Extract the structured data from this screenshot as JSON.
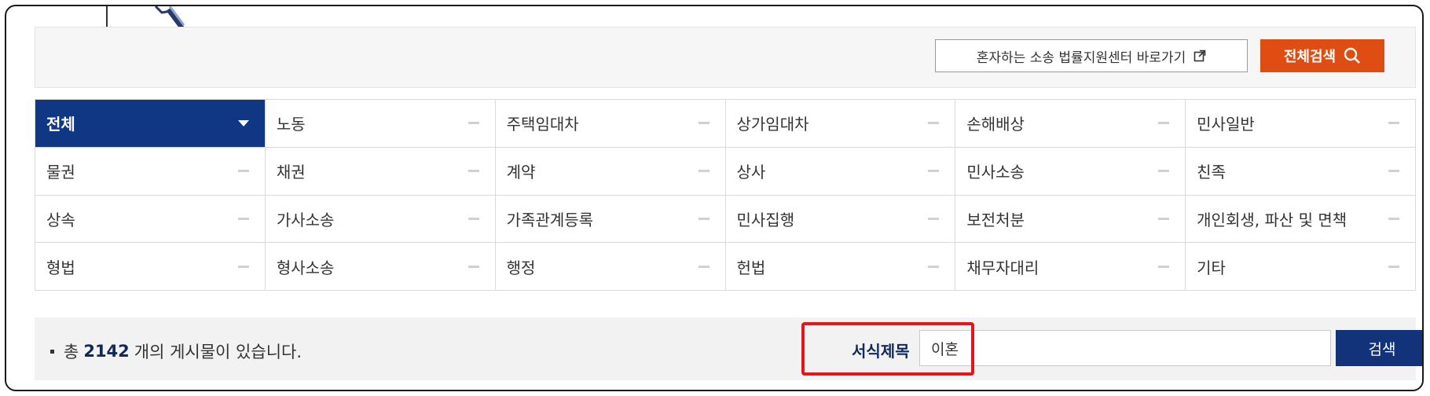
{
  "header": {
    "self_litigation_link": "혼자하는 소송 법률지원센터 바로가기",
    "search_all_label": "전체검색"
  },
  "categories": [
    [
      "전체",
      "노동",
      "주택임대차",
      "상가임대차",
      "손해배상",
      "민사일반"
    ],
    [
      "물권",
      "채권",
      "계약",
      "상사",
      "민사소송",
      "친족"
    ],
    [
      "상속",
      "가사소송",
      "가족관계등록",
      "민사집행",
      "보전처분",
      "개인회생, 파산 및 면책"
    ],
    [
      "형법",
      "형사소송",
      "행정",
      "헌법",
      "채무자대리",
      "기타"
    ]
  ],
  "result": {
    "prefix": "총",
    "count": "2142",
    "suffix": "개의 게시물이 있습니다."
  },
  "search": {
    "field_label": "서식제목",
    "value": "이혼",
    "button_label": "검색"
  },
  "colors": {
    "active_category": "#0f3784",
    "search_all_button": "#e04d12",
    "search_button": "#12337a",
    "highlight_box": "#e8141b"
  }
}
